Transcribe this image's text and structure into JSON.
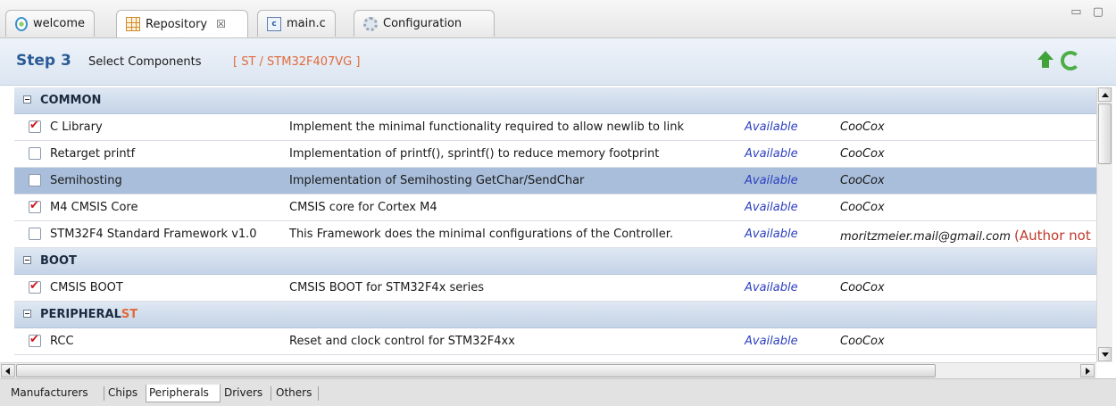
{
  "editor_tabs": [
    {
      "label": "welcome",
      "icon": "welcome-icon"
    },
    {
      "label": "Repository",
      "icon": "repository-grid-icon",
      "active": true,
      "close": "☒"
    },
    {
      "label": "main.c",
      "icon": "c-file-icon"
    },
    {
      "label": "Configuration",
      "icon": "gear-icon"
    }
  ],
  "window_controls": "▭ ▢",
  "header": {
    "step": "Step 3",
    "subtitle": "Select Components",
    "chip": "[ ST / STM32F407VG ]"
  },
  "groups": {
    "common": {
      "label": "COMMON",
      "suffix": ""
    },
    "boot": {
      "label": "BOOT",
      "suffix": ""
    },
    "peripheral": {
      "label": "PERIPHERAL",
      "suffix": "ST"
    }
  },
  "rows": [
    {
      "checked": true,
      "name": "C Library",
      "desc": "Implement the minimal functionality required to allow newlib to link",
      "status": "Available",
      "author": "CooCox",
      "note": ""
    },
    {
      "checked": false,
      "name": "Retarget printf",
      "desc": "Implementation of printf(), sprintf() to reduce memory footprint",
      "status": "Available",
      "author": "CooCox",
      "note": ""
    },
    {
      "checked": false,
      "name": "Semihosting",
      "desc": "Implementation of Semihosting GetChar/SendChar",
      "status": "Available",
      "author": "CooCox",
      "note": "",
      "selected": true
    },
    {
      "checked": true,
      "name": "M4 CMSIS Core",
      "desc": "CMSIS core for Cortex M4",
      "status": "Available",
      "author": "CooCox",
      "note": ""
    },
    {
      "checked": false,
      "name": "STM32F4 Standard Framework v1.0",
      "desc": "This Framework does the minimal configurations of the Controller.",
      "status": "Available",
      "author": "moritzmeier.mail@gmail.com",
      "note": "(Author not"
    },
    {
      "checked": true,
      "name": "CMSIS BOOT",
      "desc": "CMSIS BOOT for STM32F4x series",
      "status": "Available",
      "author": "CooCox",
      "note": ""
    },
    {
      "checked": true,
      "name": "RCC",
      "desc": "Reset and clock control for STM32F4xx",
      "status": "Available",
      "author": "CooCox",
      "note": ""
    }
  ],
  "bottom_tabs": [
    "Manufacturers",
    "Chips",
    "Peripherals",
    "Drivers",
    "Others"
  ],
  "bottom_active": "Peripherals",
  "colors": {
    "accent": "#2a5b96",
    "chip": "#e06a3a",
    "status": "#2b3fbf",
    "check": "#d0161c",
    "selected_row": "#a9bedb"
  }
}
